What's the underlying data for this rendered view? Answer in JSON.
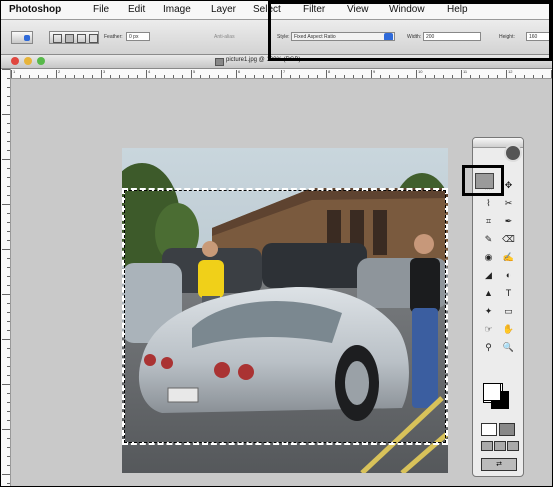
{
  "menubar": {
    "app": "Photoshop",
    "items": [
      "File",
      "Edit",
      "Image",
      "Layer",
      "Select",
      "Filter",
      "View",
      "Window",
      "Help"
    ]
  },
  "options": {
    "feather_label": "Feather:",
    "feather_value": "0 px",
    "antialias_label": "Anti-alias",
    "style_label": "Style:",
    "style_value": "Fixed Aspect Ratio",
    "width_label": "Width:",
    "width_value": "200",
    "height_label": "Height:",
    "height_value": "160"
  },
  "document": {
    "title": "picture1.jpg @ 100% (RGB)"
  },
  "ruler": {
    "top_labels": [
      "1",
      "2",
      "3",
      "4",
      "5",
      "6",
      "7",
      "8",
      "9",
      "10",
      "11",
      "12"
    ]
  },
  "tools": {
    "items": [
      "⬚",
      "✥",
      "⌇",
      "✂",
      "⌗",
      "✒",
      "✎",
      "⌫",
      "◉",
      "✍",
      "◢",
      "◐",
      "▲",
      "T",
      "✦",
      "▭",
      "☞",
      "✋",
      "⚲",
      "🔍"
    ]
  },
  "colors": {
    "menubar_bg": "#f7f7f7",
    "workspace_bg": "#c9c9c9",
    "annotation": "#000000",
    "selection": "#ffffff"
  }
}
